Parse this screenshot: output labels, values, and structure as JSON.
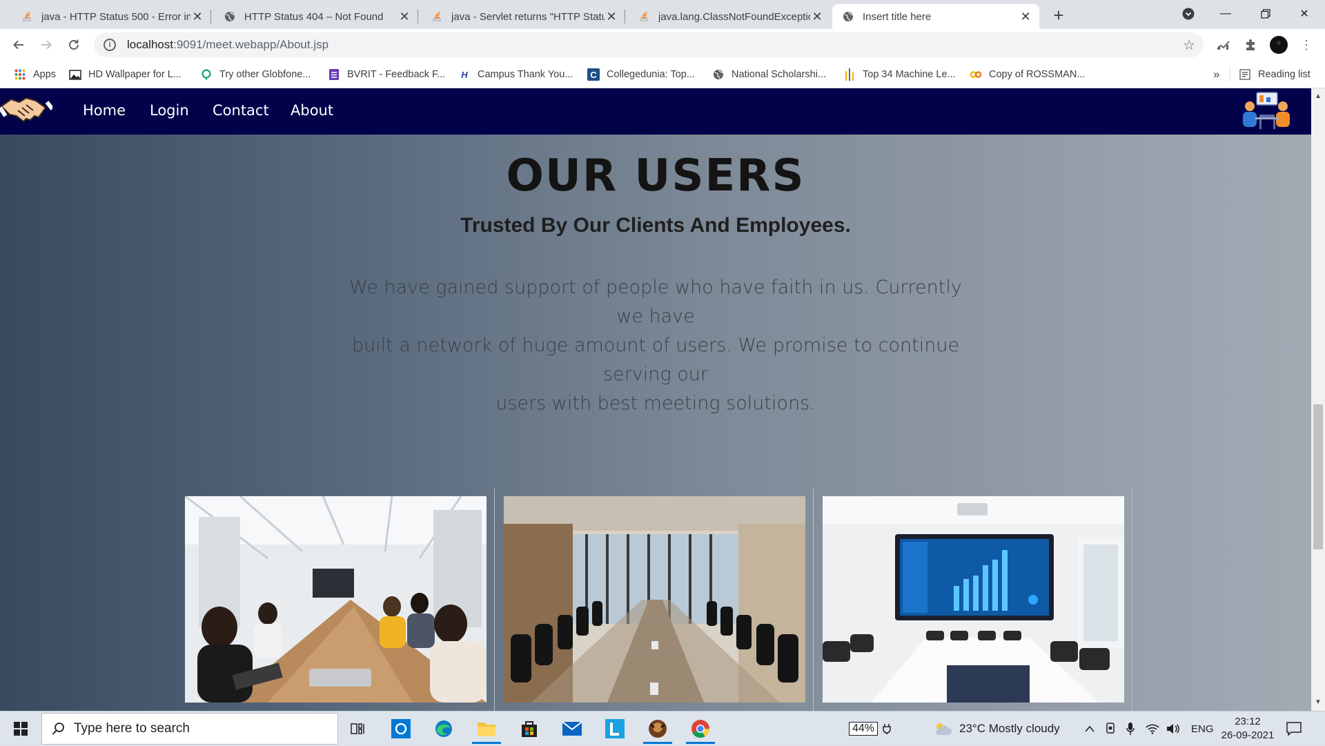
{
  "browser": {
    "tabs": [
      {
        "title": "java - HTTP Status 500 - Error ins",
        "icon": "stackoverflow-icon"
      },
      {
        "title": "HTTP Status 404 – Not Found",
        "icon": "globe-icon"
      },
      {
        "title": "java - Servlet returns \"HTTP Statu",
        "icon": "stackoverflow-icon"
      },
      {
        "title": "java.lang.ClassNotFoundExceptio",
        "icon": "stackoverflow-icon"
      },
      {
        "title": "Insert title here",
        "icon": "globe-icon",
        "active": true
      }
    ],
    "address": {
      "host": "localhost",
      "path": ":9091/meet.webapp/About.jsp"
    },
    "bookmarks": [
      {
        "label": "Apps",
        "icon": "apps-grid-icon"
      },
      {
        "label": "HD Wallpaper for L...",
        "icon": "image-icon"
      },
      {
        "label": "Try other Globfone...",
        "icon": "globfone-icon"
      },
      {
        "label": "BVRIT - Feedback F...",
        "icon": "forms-icon"
      },
      {
        "label": "Campus Thank You...",
        "icon": "hackerearth-icon"
      },
      {
        "label": "Collegedunia: Top...",
        "icon": "collegedunia-icon"
      },
      {
        "label": "National Scholarshi...",
        "icon": "globe-icon"
      },
      {
        "label": "Top 34 Machine Le...",
        "icon": "bars-icon"
      },
      {
        "label": "Copy of ROSSMAN...",
        "icon": "colab-icon"
      }
    ],
    "overflow_label": "»",
    "reading_list_label": "Reading list"
  },
  "site": {
    "nav": [
      "Home",
      "Login",
      "Contact",
      "About"
    ],
    "heading": "OUR USERS",
    "subheading": "Trusted By Our Clients And Employees.",
    "paragraph_lines": [
      "We have gained support of people who have faith in us. Currently we have",
      "built a network of huge amount of users. We promise to continue serving our",
      "users with best meeting solutions."
    ],
    "photos": [
      "meeting-team-photo",
      "boardroom-photo",
      "conference-room-screen-photo"
    ]
  },
  "taskbar": {
    "search_placeholder": "Type here to search",
    "battery": "44%",
    "weather": "23°C  Mostly cloudy",
    "language": "ENG",
    "time": "23:12",
    "date": "26-09-2021"
  },
  "colors": {
    "site_nav": "#01024a",
    "taskbar": "#dde4ec",
    "chrome_frame": "#dee1e6"
  }
}
